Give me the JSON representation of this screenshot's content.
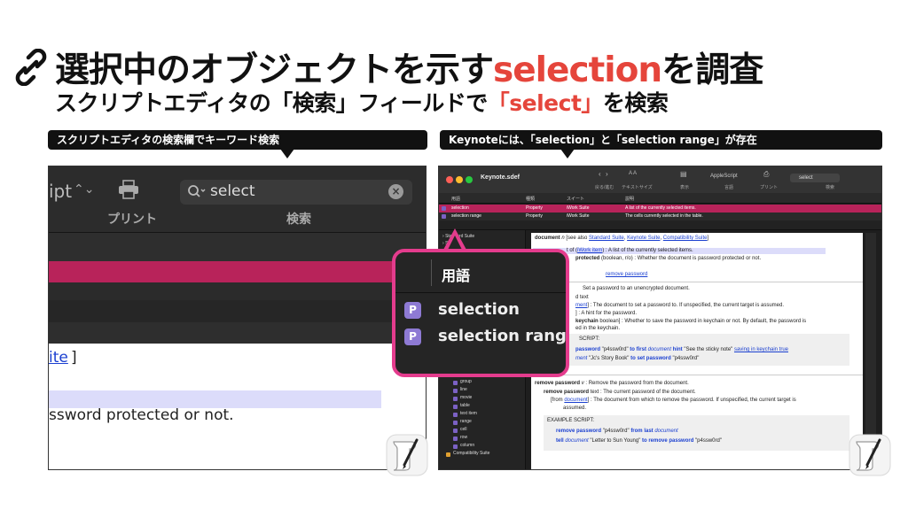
{
  "title": {
    "before": "選択中のオブジェクトを示す",
    "accent": "selection",
    "after": "を調査"
  },
  "subtitle": {
    "before": "スクリプトエディタの「検索」フィールドで",
    "accent": "「select」",
    "after": "を検索"
  },
  "callouts": {
    "left": "スクリプトエディタの検索欄でキーワード検索",
    "right": "Keynoteには、「selection」と「selection range」が存在"
  },
  "left_panel": {
    "script_partial": "ipt",
    "print_label": "プリント",
    "search_value": "select",
    "search_label": "検索",
    "link_partial": "ite",
    "bracket": "]",
    "text_partial": "ssword protected or not."
  },
  "right_panel": {
    "window_title": "Keynote.sdef",
    "toolbar": {
      "back_forward": "戻る/進む",
      "text_size": "テキストサイズ",
      "display": "表示",
      "language": "AppleScript",
      "language_label": "言語",
      "print": "プリント",
      "search_value": "select",
      "search_label": "検索"
    },
    "columns": [
      "用語",
      "種類",
      "スイート",
      "説明"
    ],
    "rows": [
      {
        "term": "selection",
        "kind": "Property",
        "suite": "iWork Suite",
        "desc": "A list of the currently selected items."
      },
      {
        "term": "selection range",
        "kind": "Property",
        "suite": "iWork Suite",
        "desc": "The cells currently selected in the table."
      }
    ],
    "sidebar": {
      "top_items": [
        "Standard Suite",
        "Suite"
      ],
      "class_items": [
        "image",
        "group",
        "line",
        "movie",
        "table",
        "text item",
        "range",
        "cell",
        "row",
        "column"
      ],
      "last_item": "Compatibility Suite"
    },
    "content": {
      "doc_line": {
        "term": "document",
        "type": "n",
        "pre": " [see also ",
        "links": [
          "Standard Suite",
          "Keynote Suite",
          "Compatibility Suite"
        ],
        "post": "]"
      },
      "item_line": {
        "pre": "t of (",
        "link": "iWork item",
        "post": ") : A list of the currently selected items."
      },
      "protected_line": {
        "term": "protected",
        "post": " (boolean, r/o) : Whether the document is password protected or not."
      },
      "remove_ref": "remove password",
      "set_line": "Set a password to an unencrypted document.",
      "text_frag": "d text",
      "ment_line": {
        "link": "ment",
        "post": "] : The document to set a password to. If unspecified, the current target is assumed."
      },
      "hint_line": "] : A hint for the password.",
      "keychain_line": {
        "term": "keychain",
        "post": " boolean] : Whether to save the password in keychain or not. By default, the password is"
      },
      "keychain_line2": "ed in the keychain.",
      "script_label": "SCRIPT:",
      "example1": {
        "kw": "password",
        "str1": " \"p4ssw0rd\" ",
        "kw2": "to first",
        "it": " document",
        "kw3": " hint",
        "str2": " \"See the sticky note\" ",
        "lnk": "saving in keychain true"
      },
      "example2": {
        "it": "ment",
        "str": " \"Jc's Story Book\" ",
        "kw": "to set password",
        "str2": " \"p4ssw0rd\""
      },
      "remove_title": {
        "term": "remove password",
        "type": "v",
        "post": " : Remove the password from the document."
      },
      "remove_text": {
        "term": "remove password",
        "post": " text : The current password of the document."
      },
      "remove_from": {
        "pre": "[from ",
        "link": "document",
        "post": "] : The document from which to remove the password. If unspecified, the current target is"
      },
      "remove_from2": "assumed.",
      "example_label": "EXAMPLE SCRIPT:",
      "example3": {
        "kw": "remove password",
        "str": " \"p4ssw0rd\" ",
        "kw2": "from last",
        "it": " document"
      },
      "example4": {
        "kw": "tell",
        "it": " document",
        "str": " \"Letter to Sun Young\" ",
        "kw2": "to remove password",
        "str2": " \"p4ssw0rd\""
      }
    }
  },
  "popup": {
    "header": "用語",
    "badge": "P",
    "items": [
      "selection",
      "selection range"
    ]
  },
  "icons": [
    "link-icon",
    "print-icon",
    "search-icon",
    "script-editor-icon"
  ],
  "colors": {
    "accent": "#e5453b",
    "popup_border": "#e43c8d",
    "selected_row": "#b8235a"
  }
}
